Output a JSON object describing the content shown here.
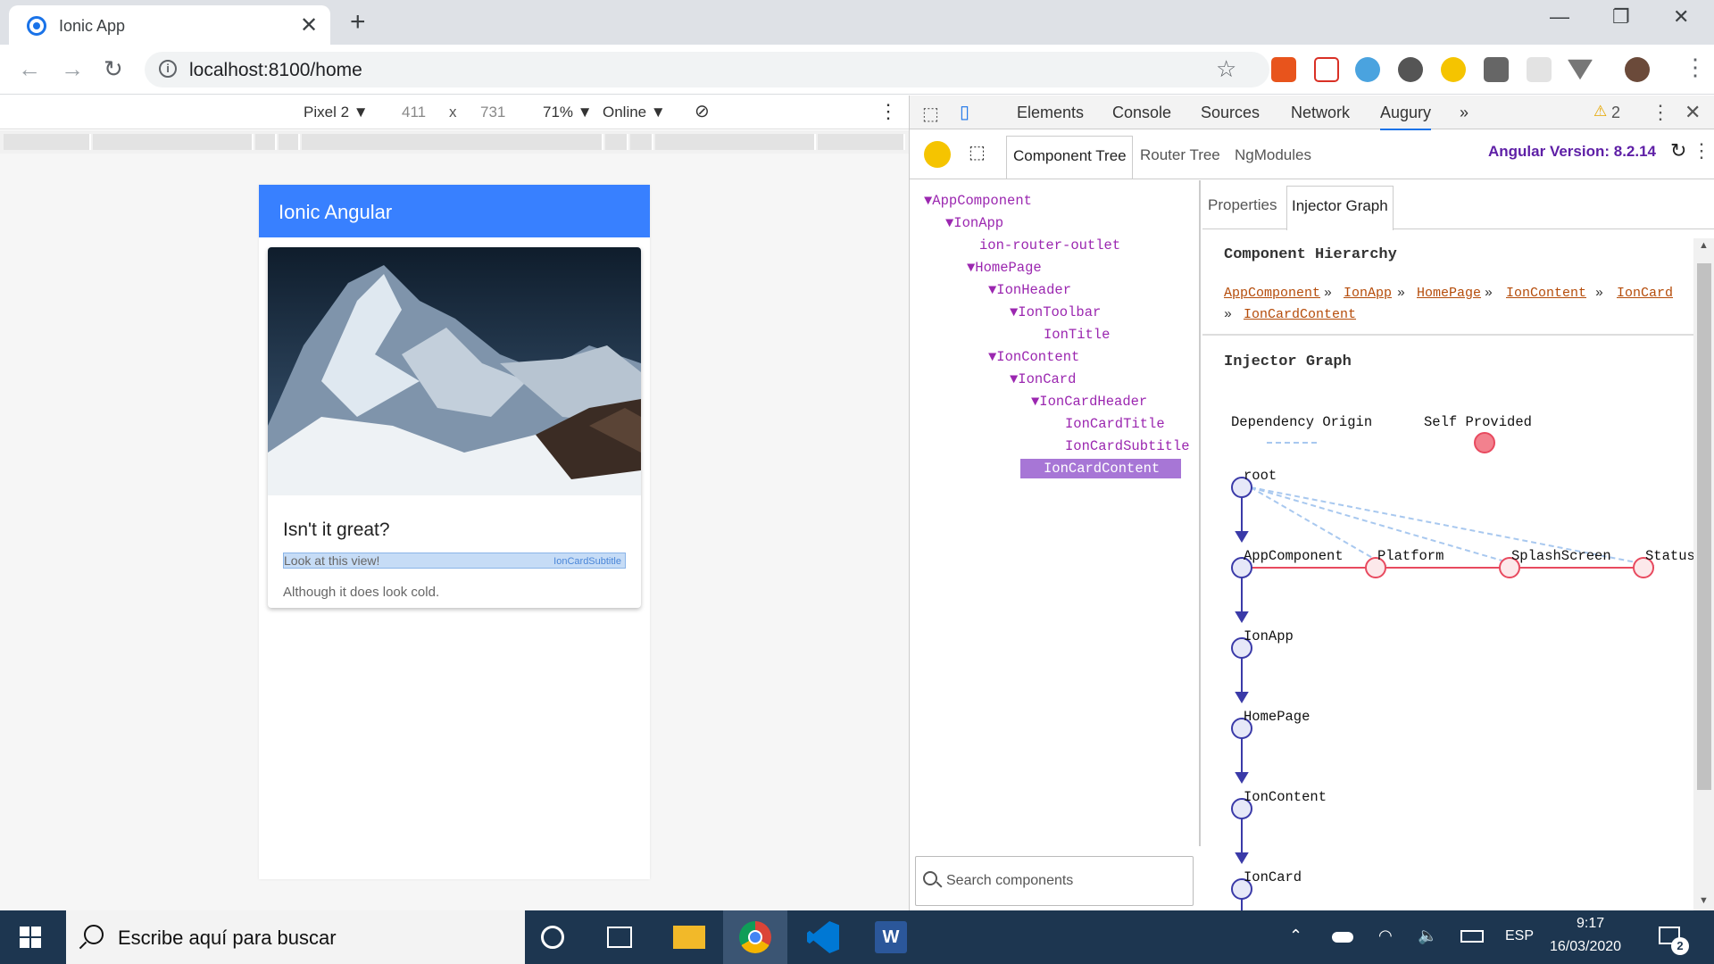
{
  "browser": {
    "tab_title": "Ionic App",
    "url": "localhost:8100/home"
  },
  "device_toolbar": {
    "device": "Pixel 2 ▼",
    "width": "411",
    "times": "x",
    "height": "731",
    "zoom": "71% ▼",
    "network": "Online ▼"
  },
  "app": {
    "toolbar_title": "Ionic Angular",
    "card_title": "Isn't it great?",
    "card_subtitle": "Look at this view!",
    "card_subtitle_overlay": "IonCardSubtitle",
    "card_content": "Although it does look cold."
  },
  "devtools": {
    "tabs": [
      "Elements",
      "Console",
      "Sources",
      "Network",
      "Augury"
    ],
    "more": "»",
    "warnings": "2",
    "augury_tabs": [
      "Component Tree",
      "Router Tree",
      "NgModules"
    ],
    "angular_version": "Angular Version: 8.2.14",
    "tree": [
      "▼AppComponent",
      "▼IonApp",
      "ion-router-outlet",
      "▼HomePage",
      "▼IonHeader",
      "▼IonToolbar",
      "IonTitle",
      "▼IonContent",
      "▼IonCard",
      "▼IonCardHeader",
      "IonCardTitle",
      "IonCardSubtitle",
      "IonCardContent"
    ],
    "search_placeholder": "Search components",
    "right_tabs": [
      "Properties",
      "Injector Graph"
    ],
    "hierarchy_title": "Component Hierarchy",
    "breadcrumbs": [
      "AppComponent",
      "IonApp",
      "HomePage",
      "IonContent",
      "IonCard",
      "IonCardContent"
    ],
    "breadcrumb_sep": "»",
    "graph_title": "Injector Graph",
    "legend": [
      "Dependency Origin",
      "Self Provided"
    ],
    "graph_nodes": [
      "root",
      "AppComponent",
      "IonApp",
      "HomePage",
      "IonContent",
      "IonCard"
    ],
    "providers": [
      "Platform",
      "SplashScreen",
      "Status"
    ]
  },
  "taskbar": {
    "search_placeholder": "Escribe aquí para buscar",
    "lang": "ESP",
    "time": "9:17",
    "date": "16/03/2020",
    "notifications": "2"
  },
  "colors": {
    "ionic_primary": "#3880ff",
    "augury_purple": "#9b27b0",
    "highlight": "#a776d6",
    "graph_blue": "#3a3aa8",
    "graph_red": "#e84a5f"
  }
}
